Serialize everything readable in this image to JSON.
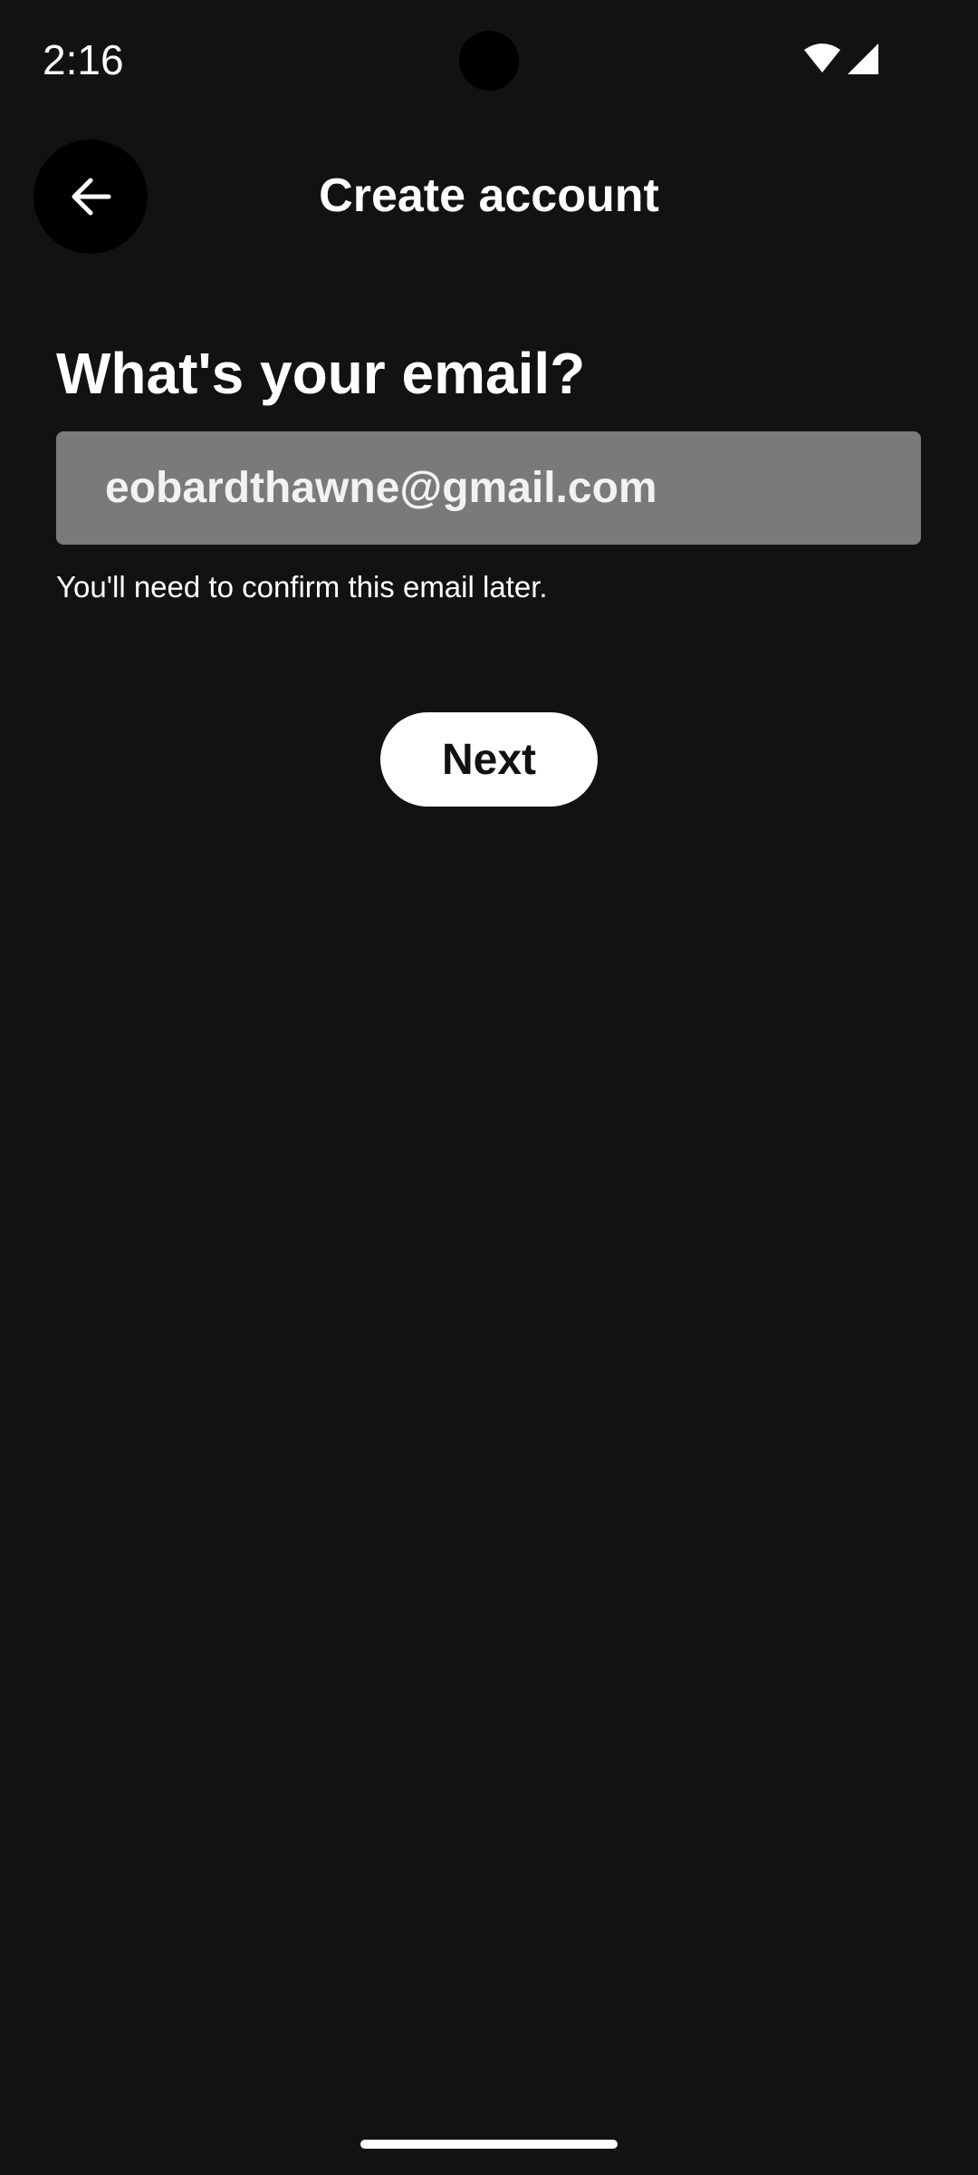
{
  "status_bar": {
    "time": "2:16",
    "icons": [
      "wifi-icon",
      "cellular-signal-icon"
    ]
  },
  "header": {
    "title": "Create account",
    "back_icon": "arrow-left-icon"
  },
  "form": {
    "heading": "What's your email?",
    "email_value": "eobardthawne@gmail.com",
    "hint": "You'll need to confirm this email later."
  },
  "actions": {
    "next_label": "Next"
  },
  "colors": {
    "background": "#121212",
    "field_background": "#7a7a7a",
    "button_background": "#ffffff",
    "button_text": "#111111"
  }
}
